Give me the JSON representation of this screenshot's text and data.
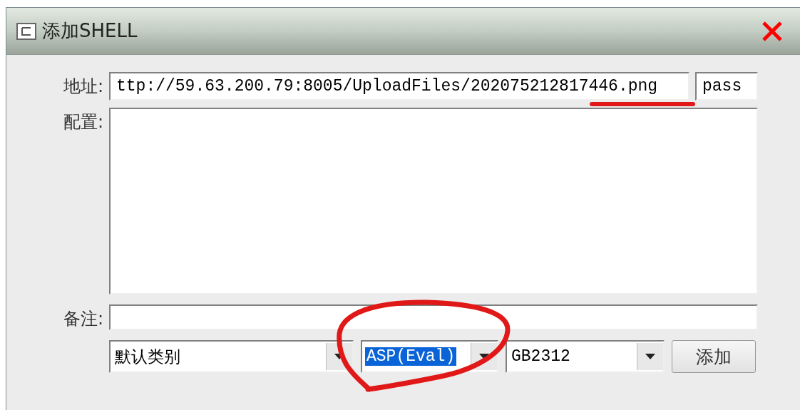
{
  "window": {
    "title": "添加SHELL"
  },
  "url_label": "地址:",
  "url": "ttp://59.63.200.79:8005/UploadFiles/202075212817446.png",
  "password": "pass",
  "config_label": "配置:",
  "remarks_label": "备注:",
  "combos": [
    {
      "value": "默认类别",
      "selected": false
    },
    {
      "value": "ASP(Eval)",
      "selected": true
    },
    {
      "value": "GB2312",
      "selected": false
    }
  ],
  "button": "添加"
}
